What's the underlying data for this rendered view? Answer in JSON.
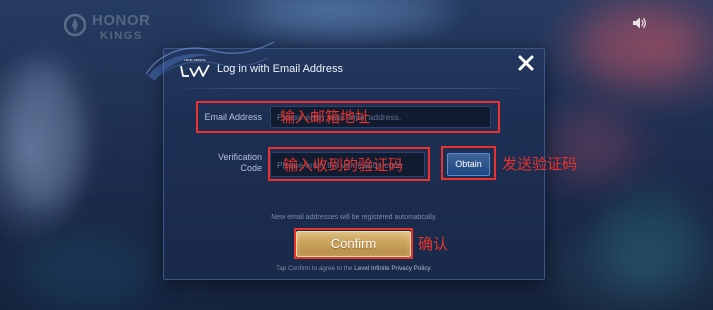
{
  "game_logo": {
    "line1": "HONOR",
    "line2": "KINGS"
  },
  "icons": {
    "speaker": "speaker-icon",
    "close": "close-icon",
    "game_emblem": "game-emblem-icon",
    "brand_logo": "level-infinite-logo"
  },
  "colors": {
    "annotation_red": "#e8322d",
    "dialog_bg": "#1c2e52",
    "obtain_blue": "#1f4c89",
    "confirm_gold": "#c89e52"
  },
  "dialog": {
    "brand_logo_text": "LEVEL INFINITE",
    "title": "Log in with Email Address",
    "email": {
      "label": "Email Address",
      "placeholder": "Please enter your email address.",
      "value": ""
    },
    "code": {
      "label": "Verification Code",
      "placeholder": "Please enter the verification code",
      "value": ""
    },
    "obtain_label": "Obtain",
    "auto_register_note": "New email addresses will be registered automatically.",
    "confirm_label": "Confirm",
    "privacy": {
      "prefix": "Tap Confirm to agree to the ",
      "link": "Level Infinite Privacy Policy",
      "suffix": "."
    }
  },
  "annotations": {
    "email_hint": "输入邮箱地址",
    "code_hint": "输入收到的验证码",
    "obtain_hint": "发送验证码",
    "confirm_hint": "确认"
  }
}
